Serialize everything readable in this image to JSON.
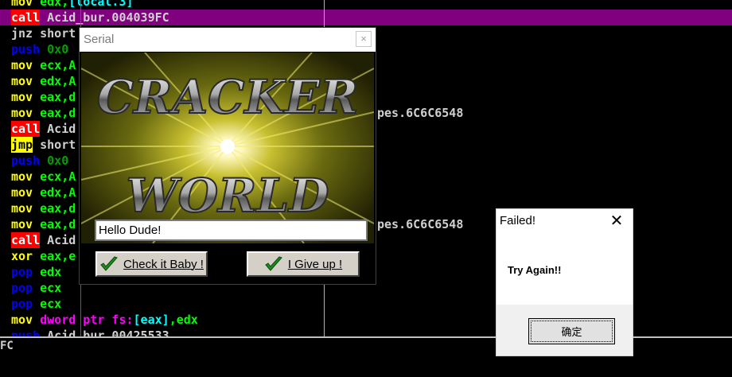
{
  "disassembly": {
    "lines": [
      {
        "mn": "mov",
        "op": [
          [
            "edx,",
            "reg"
          ],
          [
            "[local.3]",
            "br"
          ]
        ]
      },
      {
        "mn": "call",
        "op": [
          [
            "Acid_bur.004039FC",
            "txt"
          ]
        ],
        "highlight": true
      },
      {
        "mn": "jnz",
        "op": [
          [
            "short",
            "txt"
          ]
        ]
      },
      {
        "mn": "push",
        "op": [
          [
            "0x0",
            "num"
          ]
        ]
      },
      {
        "mn": "mov",
        "op": [
          [
            "ecx,A",
            "reg"
          ]
        ]
      },
      {
        "mn": "mov",
        "op": [
          [
            "edx,A",
            "reg"
          ]
        ]
      },
      {
        "mn": "mov",
        "op": [
          [
            "eax,d",
            "reg"
          ]
        ]
      },
      {
        "mn": "mov",
        "op": [
          [
            "eax,d",
            "reg"
          ]
        ]
      },
      {
        "mn": "call",
        "op": [
          [
            "Acid",
            "txt"
          ]
        ]
      },
      {
        "mn": "jmp",
        "op": [
          [
            "short",
            "txt"
          ]
        ]
      },
      {
        "mn": "push",
        "op": [
          [
            "0x0",
            "num"
          ]
        ]
      },
      {
        "mn": "mov",
        "op": [
          [
            "ecx,A",
            "reg"
          ]
        ]
      },
      {
        "mn": "mov",
        "op": [
          [
            "edx,A",
            "reg"
          ]
        ]
      },
      {
        "mn": "mov",
        "op": [
          [
            "eax,d",
            "reg"
          ]
        ]
      },
      {
        "mn": "mov",
        "op": [
          [
            "eax,d",
            "reg"
          ]
        ]
      },
      {
        "mn": "call",
        "op": [
          [
            "Acid",
            "txt"
          ]
        ]
      },
      {
        "mn": "xor",
        "op": [
          [
            "eax,e",
            "reg"
          ]
        ]
      },
      {
        "mn": "pop",
        "op": [
          [
            "edx",
            "reg"
          ]
        ]
      },
      {
        "mn": "pop",
        "op": [
          [
            "ecx",
            "reg"
          ]
        ]
      },
      {
        "mn": "pop",
        "op": [
          [
            "ecx",
            "reg"
          ]
        ]
      },
      {
        "mn": "mov",
        "op": [
          [
            "dword ptr fs:",
            "ptr"
          ],
          [
            "[eax]",
            "br"
          ],
          [
            ",edx",
            "reg"
          ]
        ]
      },
      {
        "mn": "push",
        "op": [
          [
            "Acid_bur.00425533",
            "txt"
          ]
        ]
      }
    ],
    "refs": [
      "pes.6C6C6548",
      "pes.6C6C6548"
    ],
    "status_address": "FC"
  },
  "serial_window": {
    "title": "Serial",
    "close_glyph": "×",
    "banner_line1": "CRACKER",
    "banner_line2": "WORLD",
    "input_value": "Hello Dude!",
    "check_button": "Check it Baby !",
    "giveup_button": "I Give up !"
  },
  "failed_dialog": {
    "title": "Failed!",
    "close_glyph": "✕",
    "message": "Try Again!!",
    "ok_button": "确定"
  },
  "colors": {
    "highlight_row": "#800080",
    "mnemonic_mov": "#ffff00",
    "mnemonic_call_bg": "#ff0000",
    "mnemonic_push_pop": "#0000ff",
    "register": "#00ff00",
    "bracket": "#00ffff",
    "check_icon": "#1e8a1e"
  }
}
